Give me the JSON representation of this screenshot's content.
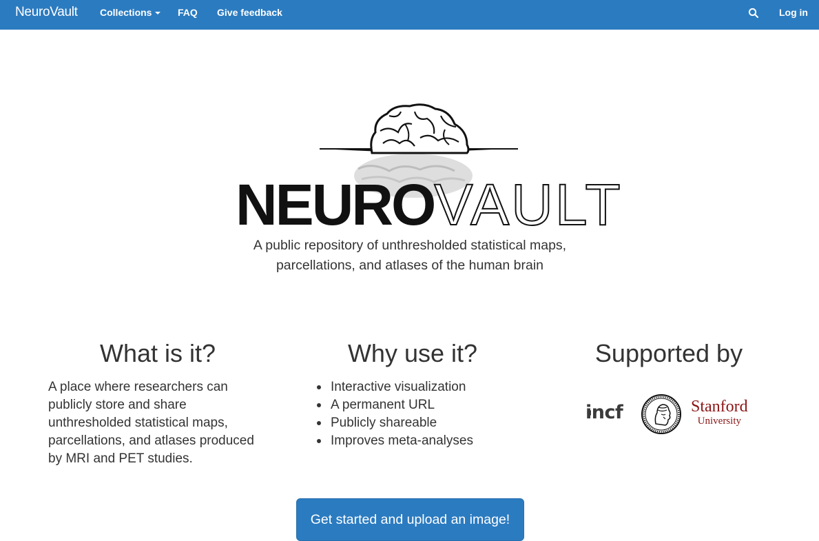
{
  "navbar": {
    "brand": "NeuroVault",
    "collections_label": "Collections",
    "faq_label": "FAQ",
    "feedback_label": "Give feedback",
    "login_label": "Log in",
    "bg_color": "#2b7bc0"
  },
  "hero": {
    "logo_word_bold": "NEURO",
    "logo_word_light": "VAULT",
    "tagline_line1": "A public repository of unthresholded statistical maps,",
    "tagline_line2": "parcellations, and atlases of the human brain"
  },
  "what": {
    "heading": "What is it?",
    "line1": "A place where researchers can",
    "line2": "publicly store and share",
    "line3": "unthresholded statistical maps,",
    "line4": "parcellations, and atlases produced",
    "line5": "by MRI and PET studies."
  },
  "why": {
    "heading": "Why use it?",
    "items": [
      {
        "label": "Interactive visualization"
      },
      {
        "label": "A permanent URL"
      },
      {
        "label": "Publicly shareable"
      },
      {
        "label": "Improves meta-analyses"
      }
    ]
  },
  "supported": {
    "heading": "Supported by",
    "incf": "incf",
    "stanford_line1": "Stanford",
    "stanford_line2": "University"
  },
  "cta": {
    "label": "Get started and upload an image!"
  },
  "icons": {
    "search": "search-icon",
    "caret": "caret-down-icon"
  }
}
